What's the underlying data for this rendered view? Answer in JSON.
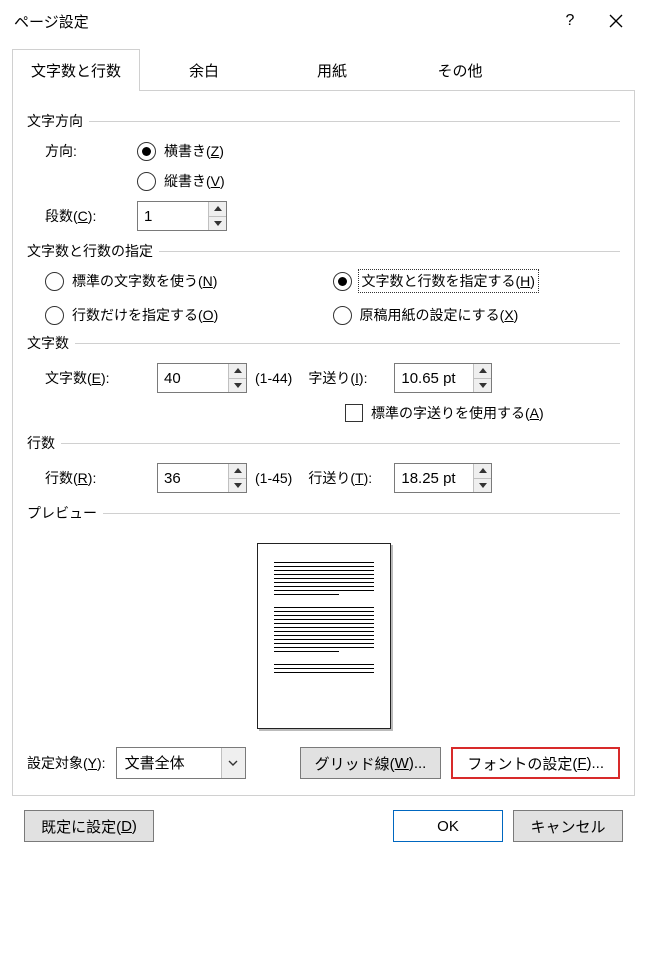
{
  "title": "ページ設定",
  "tabs": [
    "文字数と行数",
    "余白",
    "用紙",
    "その他"
  ],
  "direction_group": "文字方向",
  "direction_label": "方向:",
  "direction_horizontal_pre": "横書き(",
  "direction_horizontal_key": "Z",
  "direction_horizontal_post": ")",
  "direction_vertical_pre": "縦書き(",
  "direction_vertical_key": "V",
  "direction_vertical_post": ")",
  "columns_label_pre": "段数(",
  "columns_label_key": "C",
  "columns_label_post": "):",
  "columns_value": "1",
  "spec_group": "文字数と行数の指定",
  "spec_std_pre": "標準の文字数を使う(",
  "spec_std_key": "N",
  "spec_std_post": ")",
  "spec_both_pre": "文字数と行数を指定する(",
  "spec_both_key": "H",
  "spec_both_post": ")",
  "spec_lines_pre": "行数だけを指定する(",
  "spec_lines_key": "O",
  "spec_lines_post": ")",
  "spec_grid_pre": "原稿用紙の設定にする(",
  "spec_grid_key": "X",
  "spec_grid_post": ")",
  "chars_group": "文字数",
  "chars_label_pre": "文字数(",
  "chars_label_key": "E",
  "chars_label_post": "):",
  "chars_value": "40",
  "chars_range": "(1-44)",
  "char_pitch_label_pre": "字送り(",
  "char_pitch_label_key": "I",
  "char_pitch_label_post": "):",
  "char_pitch_value": "10.65 pt",
  "use_std_pitch_pre": "標準の字送りを使用する(",
  "use_std_pitch_key": "A",
  "use_std_pitch_post": ")",
  "lines_group": "行数",
  "lines_label_pre": "行数(",
  "lines_label_key": "R",
  "lines_label_post": "):",
  "lines_value": "36",
  "lines_range": "(1-45)",
  "line_pitch_label_pre": "行送り(",
  "line_pitch_label_key": "T",
  "line_pitch_label_post": "):",
  "line_pitch_value": "18.25 pt",
  "preview_label": "プレビュー",
  "apply_to_pre": "設定対象(",
  "apply_to_key": "Y",
  "apply_to_post": "):",
  "apply_to_value": "文書全体",
  "gridlines_btn_pre": "グリッド線(",
  "gridlines_btn_key": "W",
  "gridlines_btn_post": ")...",
  "font_btn_pre": "フォントの設定(",
  "font_btn_key": "F",
  "font_btn_post": ")...",
  "set_default_pre": "既定に設定(",
  "set_default_key": "D",
  "set_default_post": ")",
  "ok": "OK",
  "cancel": "キャンセル"
}
